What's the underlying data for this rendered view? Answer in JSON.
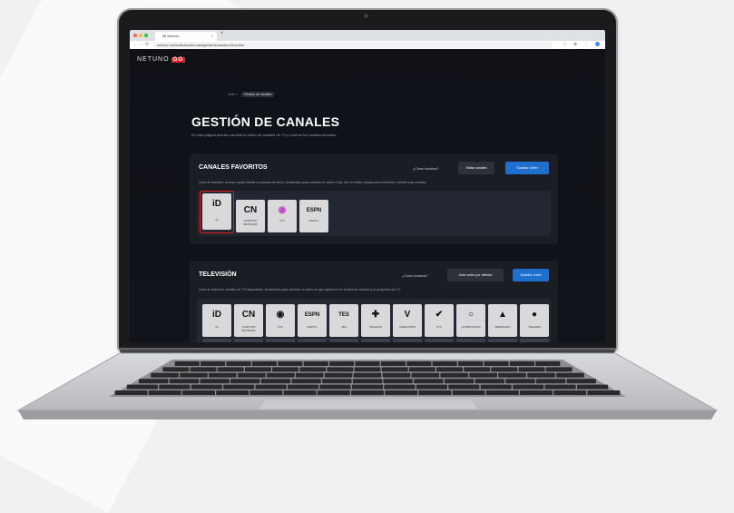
{
  "browser": {
    "tab_title": "Mi Netuno",
    "tab_close": "×",
    "new_tab": "+",
    "url": "netuno.me/institutional-management/canales-favoritos",
    "nav": [
      "←",
      "→",
      "⟳"
    ],
    "toolbar_icons": "☆ ⊕ ⋮"
  },
  "app": {
    "logo_text": "NETUNO",
    "logo_badge": "GO"
  },
  "breadcrumb": {
    "home": "Inicio  >",
    "current": "Gestión de canales"
  },
  "page": {
    "title": "GESTIÓN DE CANALES",
    "subtitle": "En esta página puedes cambiar el orden de canales de TV y ordenar los canales favoritos."
  },
  "favorites": {
    "title": "CANALES FAVORITOS",
    "help": "¿Cómo funciona?",
    "edit_button": "Editar canales",
    "save_button": "Guardar orden",
    "description": "Lista de favoritos: acceso rápido desde la pantalla de inicio. Arrástralos para cambiar el orden o haz clic en editar canales para eliminar o añadir más canales.",
    "channels": [
      {
        "icon": "iD",
        "label": "iD"
      },
      {
        "icon": "CN",
        "label": "CARTOON NETWORK"
      },
      {
        "icon": "◉",
        "label": "VTV"
      },
      {
        "icon": "ESPN",
        "label": "ESPN 2"
      }
    ]
  },
  "television": {
    "title": "TELEVISIÓN",
    "help": "¿Cómo funciona?",
    "default_button": "Usar orden por defecto",
    "save_button": "Guardar orden",
    "description": "Lista de todos los canales de TV disponibles. Arrástralos para cambiar el orden en que aparecen en la lista de canales y el programa de TV.",
    "channels": [
      {
        "icon": "iD",
        "label": "iD"
      },
      {
        "icon": "CN",
        "label": "CARTOON NETWORK"
      },
      {
        "icon": "◉",
        "label": "VTV"
      },
      {
        "icon": "ESPN",
        "label": "ESPN 2"
      },
      {
        "icon": "TES",
        "label": "TES"
      },
      {
        "icon": "✚",
        "label": "TELESUR"
      },
      {
        "icon": "V",
        "label": "VENEVISION"
      },
      {
        "icon": "✔",
        "label": "VTV"
      },
      {
        "icon": "○",
        "label": "GLOBOVISION"
      },
      {
        "icon": "▲",
        "label": "MERIDIANO"
      },
      {
        "icon": "●",
        "label": "TELEVEN"
      }
    ]
  },
  "colors": {
    "accent_blue": "#1f6fd1",
    "brand_red": "#e02424",
    "selection_red": "#e02020",
    "page_bg": "#0f1117"
  },
  "icons": {
    "back": "back-arrow-icon",
    "forward": "forward-arrow-icon",
    "reload": "reload-icon"
  }
}
